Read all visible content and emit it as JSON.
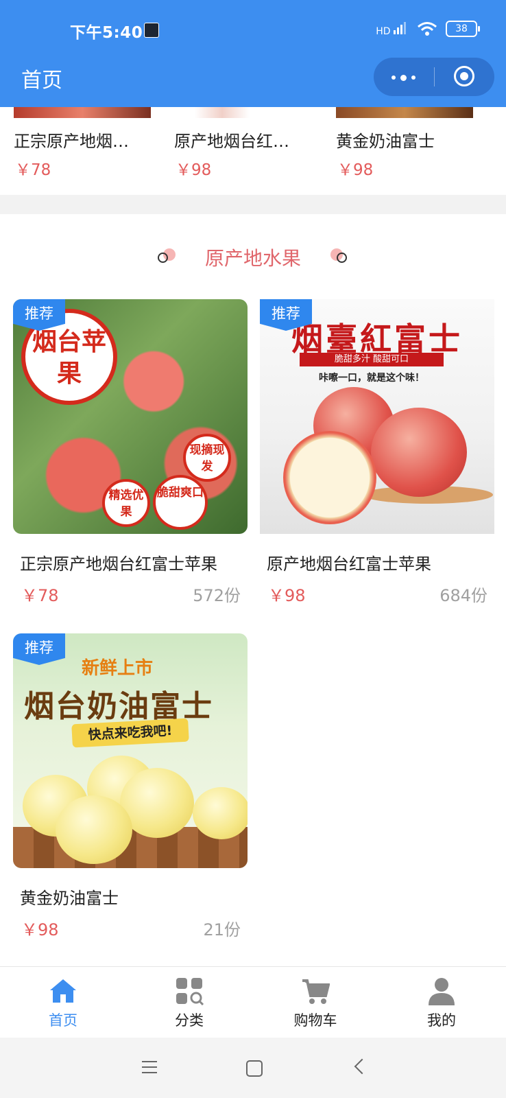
{
  "status": {
    "time": "下午5:40",
    "battery": "38",
    "network": "HD"
  },
  "nav": {
    "title": "首页"
  },
  "top_row": [
    {
      "name": "正宗原产地烟…",
      "price": "￥78"
    },
    {
      "name": "原产地烟台红…",
      "price": "￥98"
    },
    {
      "name": "黄金奶油富士",
      "price": "￥98"
    }
  ],
  "section": {
    "title": "原产地水果"
  },
  "products": [
    {
      "name": "正宗原产地烟台红富士苹果",
      "price": "￥78",
      "sold": "572份",
      "badge": "推荐",
      "img_text": {
        "circle": "烟台苹果",
        "tag1": "现摘现发",
        "tag2": "精选优果",
        "tag3": "脆甜爽口"
      }
    },
    {
      "name": "原产地烟台红富士苹果",
      "price": "￥98",
      "sold": "684份",
      "badge": "推荐",
      "img_text": {
        "head": "烟臺紅富士",
        "ribbon": "脆甜多汁  酸甜可口",
        "sub": "咔嚓一口，就是这个味！"
      }
    },
    {
      "name": "黄金奶油富士",
      "price": "￥98",
      "sold": "21份",
      "badge": "推荐",
      "img_text": {
        "t1": "新鲜上市",
        "t2": "烟台奶油富士",
        "t3": "快点来吃我吧!"
      }
    }
  ],
  "tabbar": [
    {
      "label": "首页",
      "icon": "home-icon",
      "active": true
    },
    {
      "label": "分类",
      "icon": "category-icon",
      "active": false
    },
    {
      "label": "购物车",
      "icon": "cart-icon",
      "active": false
    },
    {
      "label": "我的",
      "icon": "user-icon",
      "active": false
    }
  ],
  "colors": {
    "primary": "#3d8ef0",
    "price": "#e35b5b",
    "section": "#e0666b",
    "sold": "#a0a0a0"
  }
}
